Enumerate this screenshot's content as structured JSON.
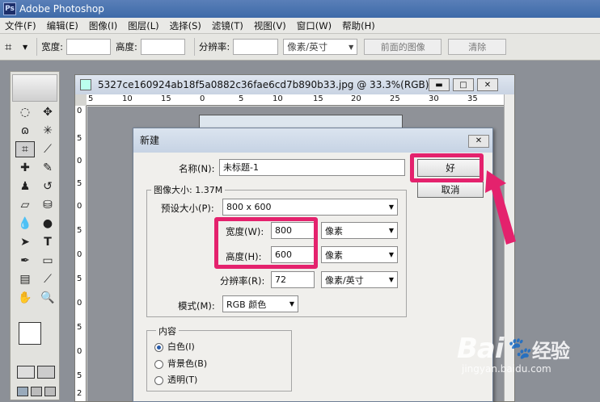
{
  "app": {
    "title": "Adobe Photoshop",
    "logo": "Ps"
  },
  "menu": [
    "文件(F)",
    "编辑(E)",
    "图像(I)",
    "图层(L)",
    "选择(S)",
    "滤镜(T)",
    "视图(V)",
    "窗口(W)",
    "帮助(H)"
  ],
  "options": {
    "width_label": "宽度:",
    "height_label": "高度:",
    "res_label": "分辨率:",
    "unit": "像素/英寸",
    "front_image": "前面的图像",
    "clear": "清除"
  },
  "document": {
    "title": "5327ce160924ab18f5a0882c36fae6cd7b890b33.jpg @ 33.3%(RGB)",
    "ruler_top": [
      "5",
      "10",
      "15",
      "0",
      "5",
      "10",
      "15",
      "20",
      "25",
      "30",
      "35"
    ],
    "ruler_left": [
      "0",
      "5",
      "0",
      "5",
      "0",
      "5",
      "0",
      "5",
      "0",
      "5",
      "0",
      "5",
      "2"
    ]
  },
  "dialog": {
    "title": "新建",
    "name_label": "名称(N):",
    "name_value": "未标题-1",
    "size_group": "图像大小: 1.37M",
    "preset_label": "预设大小(P):",
    "preset_value": "800 x 600",
    "width_label": "宽度(W):",
    "width_value": "800",
    "width_unit": "像素",
    "height_label": "高度(H):",
    "height_value": "600",
    "height_unit": "像素",
    "res_label": "分辨率(R):",
    "res_value": "72",
    "res_unit": "像素/英寸",
    "mode_label": "模式(M):",
    "mode_value": "RGB 颜色",
    "content_group": "内容",
    "content_options": [
      "白色(I)",
      "背景色(B)",
      "透明(T)"
    ],
    "content_selected": 0,
    "ok": "好",
    "cancel": "取消"
  },
  "watermark": {
    "brand": "Bai",
    "brand2": "经验",
    "url": "jingyan.baidu.com"
  },
  "colors": {
    "highlight": "#e4226d"
  }
}
